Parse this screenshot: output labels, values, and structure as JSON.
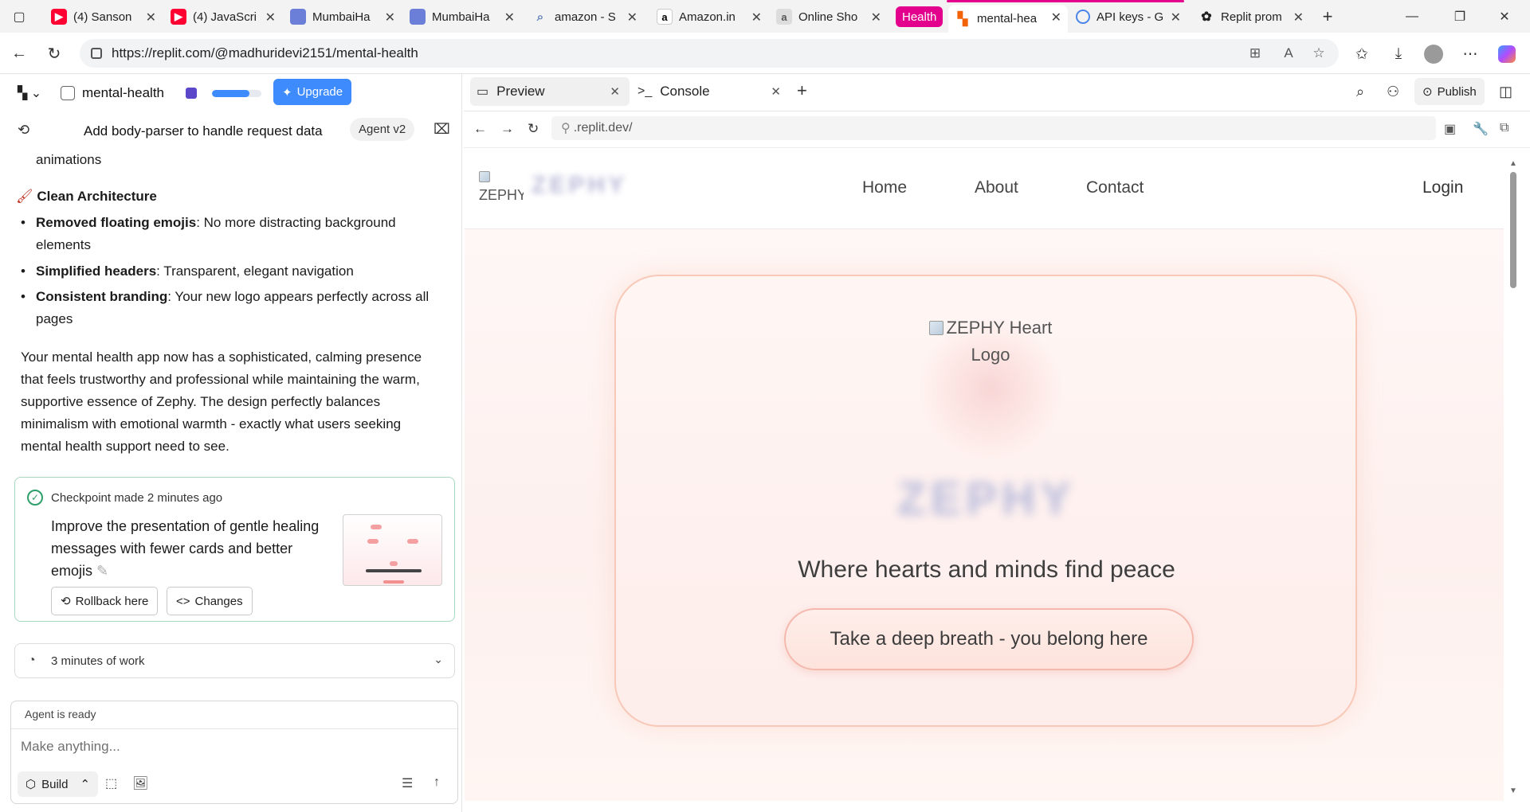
{
  "browser": {
    "tabs": [
      {
        "label": "(4) Sanson",
        "favicon": "youtube-icon",
        "color": "#ff0033"
      },
      {
        "label": "(4) JavaScri",
        "favicon": "youtube-icon",
        "color": "#ff0033"
      },
      {
        "label": "MumbaiHa",
        "favicon": "page-icon",
        "color": "#6b7fd8"
      },
      {
        "label": "MumbaiHa",
        "favicon": "page-icon",
        "color": "#6b7fd8"
      },
      {
        "label": "amazon - S",
        "favicon": "search-icon",
        "color": "#5f7fb8"
      },
      {
        "label": "Amazon.in",
        "favicon": "amazon-icon",
        "color": "#000000"
      },
      {
        "label": "Online Sho",
        "favicon": "amazon-icon",
        "color": "#888888"
      },
      {
        "label": "mental-hea",
        "favicon": "replit-icon",
        "color": "#f26207"
      },
      {
        "label": "API keys - G",
        "favicon": "google-icon",
        "color": "#4a86e8"
      },
      {
        "label": "Replit prom",
        "favicon": "openai-icon",
        "color": "#222222"
      }
    ],
    "tab_group_label": "Health",
    "tab_group_color": "#e3008c",
    "url": "https://replit.com/@madhuridevi2151/mental-health"
  },
  "replit": {
    "project_name": "mental-health",
    "usage_fraction": 0.75,
    "upgrade_label": "Upgrade",
    "thread_title": "Add body-parser to handle request data",
    "agent_badge": "Agent v2",
    "message": {
      "continued_line": "animations",
      "section_heading": "Clean Architecture",
      "bullets": [
        {
          "bold": "Removed floating emojis",
          "rest_line1": ": No more distracting background",
          "rest_line2": "elements"
        },
        {
          "bold": "Simplified headers",
          "rest_line1": ": Transparent, elegant navigation"
        },
        {
          "bold": "Consistent branding",
          "rest_line1": ": Your new logo appears perfectly across all",
          "rest_line2": "pages"
        }
      ],
      "paragraph_lines": [
        "Your mental health app now has a sophisticated, calming presence",
        "that feels trustworthy and professional while maintaining the warm,",
        "supportive essence of Zephy. The design perfectly balances",
        "minimalism with emotional warmth - exactly what users seeking",
        "mental health support need to see."
      ]
    },
    "checkpoint": {
      "label": "Checkpoint made",
      "time": "2 minutes ago",
      "title_lines": [
        "Improve the presentation of gentle healing",
        "messages with fewer cards and better",
        "emojis"
      ],
      "rollback_label": "Rollback here",
      "changes_label": "Changes"
    },
    "work_summary": "3 minutes of work",
    "composer": {
      "status": "Agent is ready",
      "placeholder": "Make anything...",
      "mode_label": "Build"
    },
    "preview": {
      "tab_preview": "Preview",
      "tab_console": "Console",
      "publish_label": "Publish",
      "url": ".replit.dev/"
    }
  },
  "site": {
    "broken_logo_alt": "ZEPHY",
    "nav": [
      "Home",
      "About",
      "Contact"
    ],
    "login": "Login",
    "hero_logo_alt_line1": "ZEPHY Heart",
    "hero_logo_alt_line2": "Logo",
    "tagline": "Where hearts and minds find peace",
    "cta": "Take a deep breath - you belong here"
  }
}
